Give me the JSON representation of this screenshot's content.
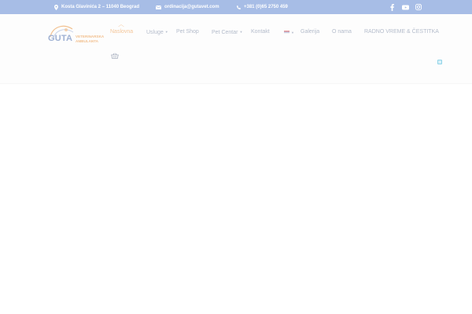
{
  "topbar": {
    "address": "Kosta Glavinića 2 – 11040 Beograd",
    "email": "ordinacija@gutavet.com",
    "phone": "+381 (0)65 2750 459",
    "social_icons": [
      "facebook-icon",
      "youtube-icon",
      "instagram-icon"
    ],
    "background": "#a7bde6"
  },
  "logo": {
    "brand": "GUTA",
    "subtitle_line1": "VETERINARSKA",
    "subtitle_line2": "AMBULANTA"
  },
  "nav": {
    "items": [
      {
        "label": "Naslovna",
        "active": true
      },
      {
        "label": "Usluge",
        "has_dropdown": true
      },
      {
        "label": "Pet Shop"
      },
      {
        "label": "Pet Centar",
        "has_dropdown": true
      },
      {
        "label": "Kontakt"
      },
      {
        "label": "Galerija"
      },
      {
        "label": "O nama"
      },
      {
        "label": "RADNO VREME & ČESTITKA"
      }
    ],
    "caret": "▼"
  },
  "colors": {
    "accent": "#f4c69a",
    "nav_text": "#b4bccb"
  }
}
